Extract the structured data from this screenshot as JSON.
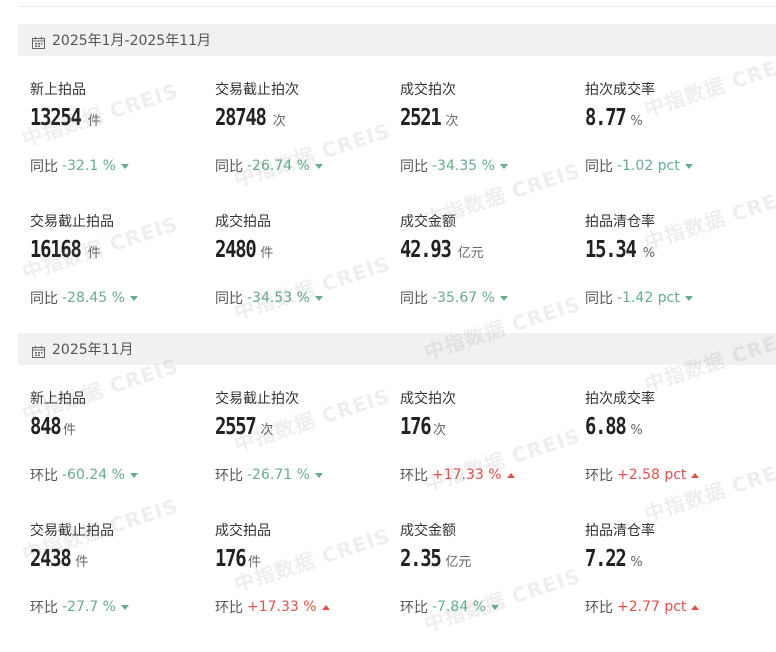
{
  "sections": [
    {
      "title": "2025年1月-2025年11月",
      "metrics": [
        {
          "label": "新上拍品",
          "value": "13254",
          "unit": "件",
          "cmp_label": "同比",
          "cmp_value": "-32.1 %",
          "dir": "down"
        },
        {
          "label": "交易截止拍次",
          "value": "28748",
          "unit": "次",
          "cmp_label": "同比",
          "cmp_value": "-26.74 %",
          "dir": "down"
        },
        {
          "label": "成交拍次",
          "value": "2521",
          "unit": "次",
          "cmp_label": "同比",
          "cmp_value": "-34.35 %",
          "dir": "down"
        },
        {
          "label": "拍次成交率",
          "value": "8.77",
          "unit": "%",
          "cmp_label": "同比",
          "cmp_value": "-1.02 pct",
          "dir": "down"
        },
        {
          "label": "交易截止拍品",
          "value": "16168",
          "unit": "件",
          "cmp_label": "同比",
          "cmp_value": "-28.45 %",
          "dir": "down"
        },
        {
          "label": "成交拍品",
          "value": "2480",
          "unit": "件",
          "cmp_label": "同比",
          "cmp_value": "-34.53 %",
          "dir": "down"
        },
        {
          "label": "成交金额",
          "value": "42.93",
          "unit": "亿元",
          "cmp_label": "同比",
          "cmp_value": "-35.67 %",
          "dir": "down"
        },
        {
          "label": "拍品清仓率",
          "value": "15.34",
          "unit": "%",
          "cmp_label": "同比",
          "cmp_value": "-1.42 pct",
          "dir": "down"
        }
      ]
    },
    {
      "title": "2025年11月",
      "metrics": [
        {
          "label": "新上拍品",
          "value": "848",
          "unit": "件",
          "cmp_label": "环比",
          "cmp_value": "-60.24 %",
          "dir": "down"
        },
        {
          "label": "交易截止拍次",
          "value": "2557",
          "unit": "次",
          "cmp_label": "环比",
          "cmp_value": "-26.71 %",
          "dir": "down"
        },
        {
          "label": "成交拍次",
          "value": "176",
          "unit": "次",
          "cmp_label": "环比",
          "cmp_value": "+17.33 %",
          "dir": "up"
        },
        {
          "label": "拍次成交率",
          "value": "6.88",
          "unit": "%",
          "cmp_label": "环比",
          "cmp_value": "+2.58 pct",
          "dir": "up"
        },
        {
          "label": "交易截止拍品",
          "value": "2438",
          "unit": "件",
          "cmp_label": "环比",
          "cmp_value": "-27.7 %",
          "dir": "down"
        },
        {
          "label": "成交拍品",
          "value": "176",
          "unit": "件",
          "cmp_label": "环比",
          "cmp_value": "+17.33 %",
          "dir": "up"
        },
        {
          "label": "成交金额",
          "value": "2.35",
          "unit": "亿元",
          "cmp_label": "环比",
          "cmp_value": "-7.84 %",
          "dir": "down"
        },
        {
          "label": "拍品清仓率",
          "value": "7.22",
          "unit": "%",
          "cmp_label": "环比",
          "cmp_value": "+2.77 pct",
          "dir": "up"
        }
      ]
    }
  ],
  "watermark": "中指数据 CREIS",
  "colors": {
    "down": "#67ad8b",
    "up": "#e0524b",
    "header_bg": "#f1f1f1"
  },
  "icons": {
    "section_header": "calendar-icon",
    "down": "triangle-down-icon",
    "up": "triangle-up-icon"
  }
}
